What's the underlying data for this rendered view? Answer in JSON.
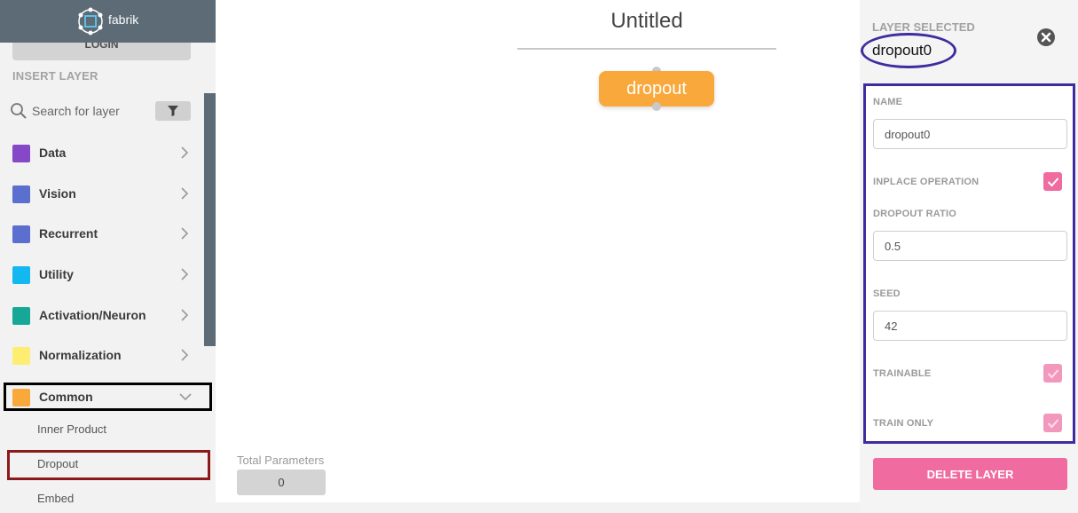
{
  "brand": {
    "name": "fabrik"
  },
  "sidebar": {
    "login_label": "LOGIN",
    "insert_heading": "INSERT LAYER",
    "search_placeholder": "Search for layer",
    "categories": [
      {
        "label": "Data",
        "color": "#8548c6",
        "expanded": false
      },
      {
        "label": "Vision",
        "color": "#5b6fcf",
        "expanded": false
      },
      {
        "label": "Recurrent",
        "color": "#5b6fcf",
        "expanded": false
      },
      {
        "label": "Utility",
        "color": "#14b8f0",
        "expanded": false
      },
      {
        "label": "Activation/Neuron",
        "color": "#16a896",
        "expanded": false
      },
      {
        "label": "Normalization",
        "color": "#fdee71",
        "expanded": false
      },
      {
        "label": "Common",
        "color": "#f9a83c",
        "expanded": true
      }
    ],
    "common_items": [
      "Inner Product",
      "Dropout",
      "Embed"
    ]
  },
  "canvas": {
    "title": "Untitled",
    "node_label": "dropout",
    "node_color": "#f9a83c",
    "total_params_label": "Total Parameters",
    "total_params_value": "0"
  },
  "panel": {
    "heading": "LAYER SELECTED",
    "layer_name": "dropout0",
    "fields": {
      "name_label": "NAME",
      "name_value": "dropout0",
      "inplace_label": "INPLACE OPERATION",
      "inplace_checked": true,
      "ratio_label": "DROPOUT RATIO",
      "ratio_value": "0.5",
      "seed_label": "SEED",
      "seed_value": "42",
      "trainable_label": "TRAINABLE",
      "trainable_checked": true,
      "train_only_label": "TRAIN ONLY",
      "train_only_checked": true
    },
    "delete_label": "DELETE LAYER",
    "accent_color": "#f06ca0"
  }
}
